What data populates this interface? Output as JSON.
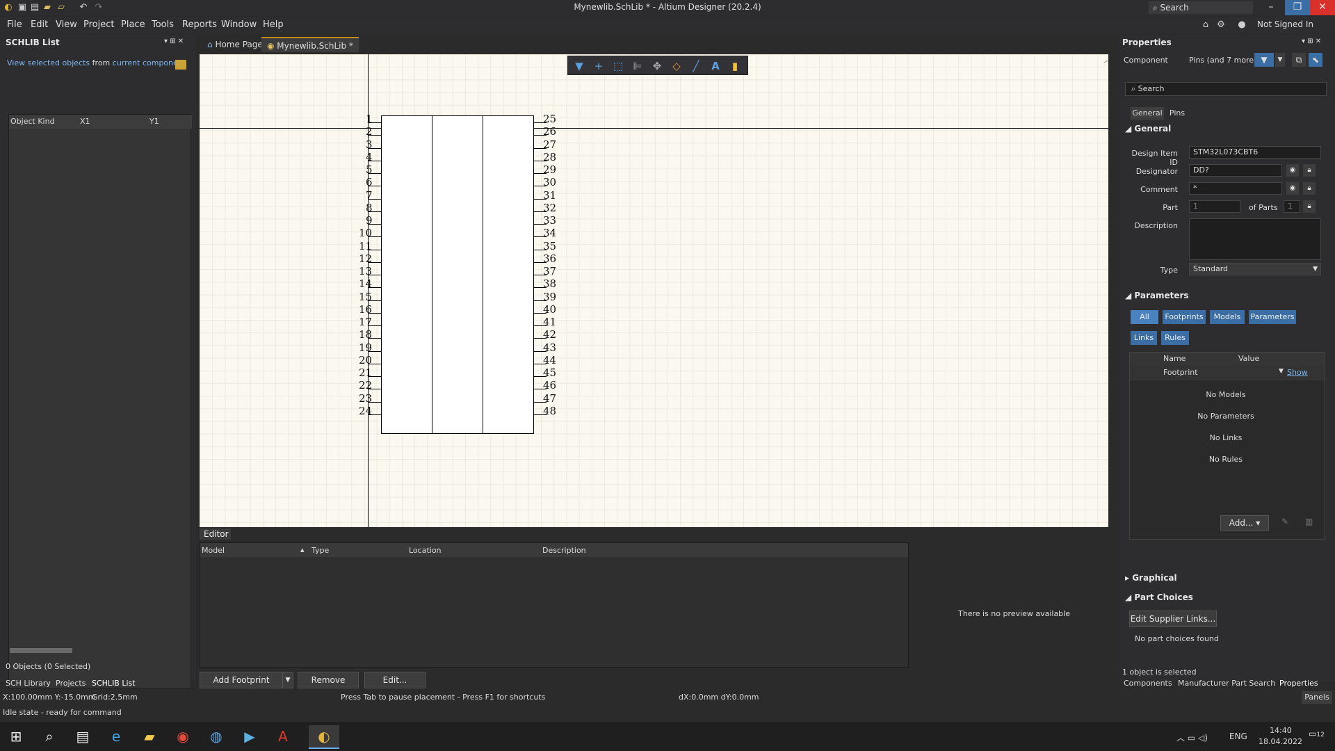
{
  "window": {
    "title": "Mynewlib.SchLib * - Altium Designer (20.2.4)",
    "search_label": "Search",
    "controls": {
      "minimize": "–",
      "restore": "❐",
      "close": "✕"
    }
  },
  "menu": {
    "items": [
      "File",
      "Edit",
      "View",
      "Project",
      "Place",
      "Tools",
      "Reports",
      "Window",
      "Help"
    ],
    "right_label": "Not Signed In"
  },
  "left_panel": {
    "title": "SCHLIB List",
    "view_prefix": "View selected objects",
    "view_from": "from",
    "view_link": "current component",
    "columns": [
      "Object Kind",
      "X1",
      "Y1"
    ],
    "objects_count": "0 Objects (0 Selected)",
    "tabs": [
      "SCH Library",
      "Projects",
      "SCHLIB List"
    ]
  },
  "doc_tabs": {
    "home": "Home Page",
    "active": "Mynewlib.SchLib *"
  },
  "canvas": {
    "left_pins": [
      "1",
      "2",
      "3",
      "4",
      "5",
      "6",
      "7",
      "8",
      "9",
      "10",
      "11",
      "12",
      "13",
      "14",
      "15",
      "16",
      "17",
      "18",
      "19",
      "20",
      "21",
      "22",
      "23",
      "24"
    ],
    "right_pins": [
      "25",
      "26",
      "27",
      "28",
      "29",
      "30",
      "31",
      "32",
      "33",
      "34",
      "35",
      "36",
      "37",
      "38",
      "39",
      "40",
      "41",
      "42",
      "43",
      "44",
      "45",
      "46",
      "47",
      "48"
    ]
  },
  "toolbar": {
    "icons": [
      "filter-icon",
      "crosshair-icon",
      "select-rect-icon",
      "align-icon",
      "move-icon",
      "erase-icon",
      "line-icon",
      "text-icon",
      "note-icon"
    ]
  },
  "editor": {
    "label": "Editor",
    "columns": [
      "Model",
      "Type",
      "Location",
      "Description"
    ],
    "no_preview": "There is no preview available",
    "buttons": {
      "add_footprint": "Add Footprint",
      "remove": "Remove",
      "edit": "Edit..."
    }
  },
  "properties": {
    "title": "Properties",
    "component_label": "Component",
    "filter_label": "Pins (and 7 more)",
    "search_placeholder": "Search",
    "tabs": [
      "General",
      "Pins"
    ],
    "general_title": "General",
    "design_item_id_label": "Design Item ID",
    "design_item_id": "STM32L073CBT6",
    "designator_label": "Designator",
    "designator": "DD?",
    "comment_label": "Comment",
    "comment": "*",
    "part_label": "Part",
    "part": "1",
    "of_parts_label": "of Parts",
    "of_parts": "1",
    "description_label": "Description",
    "description": "",
    "type_label": "Type",
    "type": "Standard",
    "parameters_title": "Parameters",
    "param_chips": [
      "All",
      "Footprints",
      "Models",
      "Parameters",
      "Links",
      "Rules"
    ],
    "param_columns": [
      "Name",
      "Value"
    ],
    "footprint_name": "Footprint",
    "footprint_show": "Show",
    "empty_rows": [
      "No Models",
      "No Parameters",
      "No Links",
      "No Rules"
    ],
    "add_button": "Add...",
    "graphical_title": "Graphical",
    "part_choices_title": "Part Choices",
    "edit_supplier_links": "Edit Supplier Links...",
    "no_part_choices": "No part choices found",
    "selected_status": "1 object is selected",
    "bottom_tabs": [
      "Components",
      "Manufacturer Part Search",
      "Properties"
    ]
  },
  "status": {
    "coords": "X:100.00mm Y:-15.0mm",
    "grid": "Grid:2.5mm",
    "hint": "Press Tab to pause placement - Press F1 for shortcuts",
    "delta": "dX:0.0mm dY:0.0mm",
    "idle": "Idle state - ready for command",
    "panels": "Panels"
  },
  "taskbar": {
    "lang": "ENG",
    "time": "14:40",
    "date": "18.04.2022",
    "notifications": "12"
  }
}
